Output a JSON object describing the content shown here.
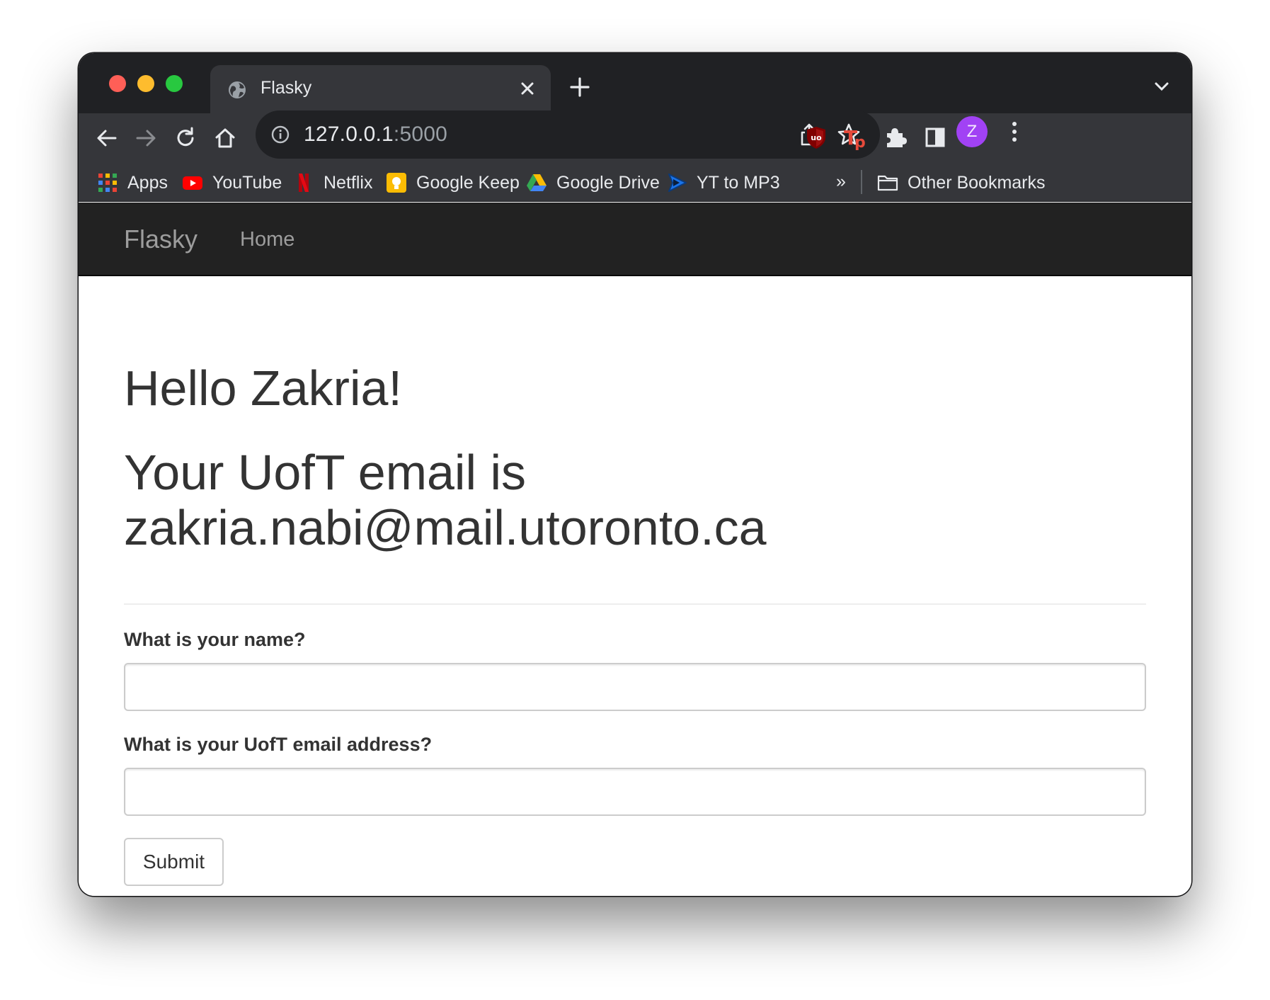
{
  "browser": {
    "tab": {
      "title": "Flasky"
    },
    "address_bar": {
      "host": "127.0.0.1",
      "port": ":5000"
    },
    "profile_initial": "Z",
    "bookmarks": [
      {
        "label": "Apps",
        "icon": "apps-grid-icon"
      },
      {
        "label": "YouTube",
        "icon": "youtube-icon"
      },
      {
        "label": "Netflix",
        "icon": "netflix-icon"
      },
      {
        "label": "Google Keep",
        "icon": "google-keep-icon"
      },
      {
        "label": "Google Drive",
        "icon": "google-drive-icon"
      },
      {
        "label": "YT to MP3",
        "icon": "yt-to-mp3-icon"
      }
    ],
    "bookmarks_overflow": "»",
    "other_bookmarks": "Other Bookmarks"
  },
  "navbar": {
    "brand": "Flasky",
    "home": "Home"
  },
  "main": {
    "greeting": "Hello Zakria!",
    "email_line1": "Your UofT email is",
    "email_line2": "zakria.nabi@mail.utoronto.ca"
  },
  "form": {
    "name_label": "What is your name?",
    "name_value": "",
    "email_label": "What is your UofT email address?",
    "email_value": "",
    "submit_label": "Submit"
  },
  "colors": {
    "chrome_dark": "#202124",
    "chrome_toolbar": "#35363a",
    "navbar_bg": "#222222",
    "navbar_text": "#9d9d9d",
    "heading_text": "#333333",
    "avatar": "#a142f4"
  }
}
